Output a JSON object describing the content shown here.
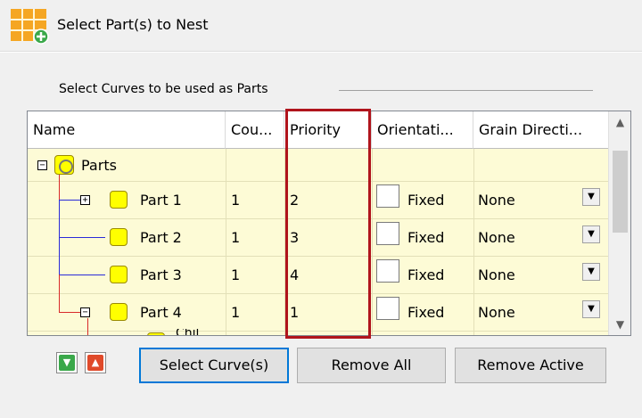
{
  "header": {
    "title": "Select Part(s) to Nest",
    "icon": "nest-grid-add-icon"
  },
  "group": {
    "label": "Select Curves to be used as Parts"
  },
  "columns": [
    "Name",
    "Cou...",
    "Priority",
    "Orientati...",
    "Grain Directi..."
  ],
  "tree": {
    "root": {
      "label": "Parts",
      "expander": "⊟"
    },
    "rows": [
      {
        "label": "Part 1",
        "count": "1",
        "priority": "2",
        "orientation": "Fixed",
        "grain": "None",
        "expander": "⊞"
      },
      {
        "label": "Part 2",
        "count": "1",
        "priority": "3",
        "orientation": "Fixed",
        "grain": "None"
      },
      {
        "label": "Part 3",
        "count": "1",
        "priority": "4",
        "orientation": "Fixed",
        "grain": "None"
      },
      {
        "label": "Part 4",
        "count": "1",
        "priority": "1",
        "orientation": "Fixed",
        "grain": "None",
        "expander": "⊟"
      }
    ],
    "partial_child": "Chil"
  },
  "buttons": {
    "select": "Select Curve(s)",
    "remove_all": "Remove All",
    "remove_active": "Remove Active"
  },
  "colors": {
    "grid_bg": "#fdfbd6",
    "highlight": "#b0141c",
    "focus": "#0078d7"
  }
}
